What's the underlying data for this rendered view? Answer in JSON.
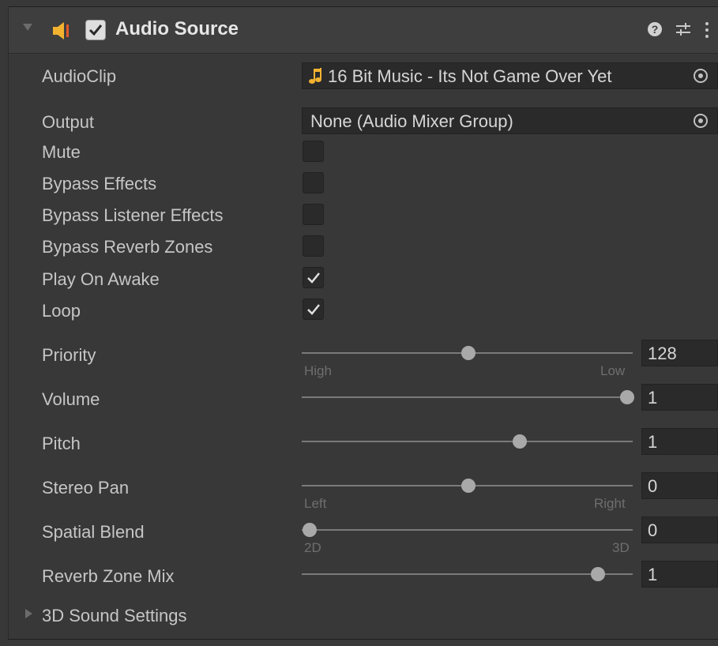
{
  "header": {
    "title": "Audio Source",
    "enabled": true,
    "icons": [
      "foldout-arrow-icon",
      "speaker-icon",
      "help-icon",
      "preset-icon",
      "more-menu-icon"
    ]
  },
  "fields": {
    "audio_clip": {
      "label": "AudioClip",
      "value": "16 Bit Music  - Its Not Game Over Yet",
      "icon": "music-note-icon"
    },
    "output": {
      "label": "Output",
      "value": "None (Audio Mixer Group)"
    },
    "mute": {
      "label": "Mute",
      "checked": false
    },
    "bypass_effects": {
      "label": "Bypass Effects",
      "checked": false
    },
    "bypass_listener_effects": {
      "label": "Bypass Listener Effects",
      "checked": false
    },
    "bypass_reverb_zones": {
      "label": "Bypass Reverb Zones",
      "checked": false
    },
    "play_on_awake": {
      "label": "Play On Awake",
      "checked": true
    },
    "loop": {
      "label": "Loop",
      "checked": true
    }
  },
  "sliders": {
    "priority": {
      "label": "Priority",
      "value": "128",
      "min": 0,
      "max": 256,
      "left_caption": "High",
      "right_caption": "Low"
    },
    "volume": {
      "label": "Volume",
      "value": "1",
      "min": 0,
      "max": 1
    },
    "pitch": {
      "label": "Pitch",
      "value": "1",
      "min": -3,
      "max": 3
    },
    "stereo_pan": {
      "label": "Stereo Pan",
      "value": "0",
      "min": -1,
      "max": 1,
      "left_caption": "Left",
      "right_caption": "Right"
    },
    "spatial_blend": {
      "label": "Spatial Blend",
      "value": "0",
      "min": 0,
      "max": 1,
      "left_caption": "2D",
      "right_caption": "3D"
    },
    "reverb_zone_mix": {
      "label": "Reverb Zone Mix",
      "value": "1",
      "min": 0,
      "max": 1.1
    }
  },
  "foldout": {
    "label": "3D Sound Settings"
  },
  "colors": {
    "background": "#383838",
    "field": "#2a2a2a",
    "text": "#c4c4c4",
    "speaker": "#f2b230"
  }
}
